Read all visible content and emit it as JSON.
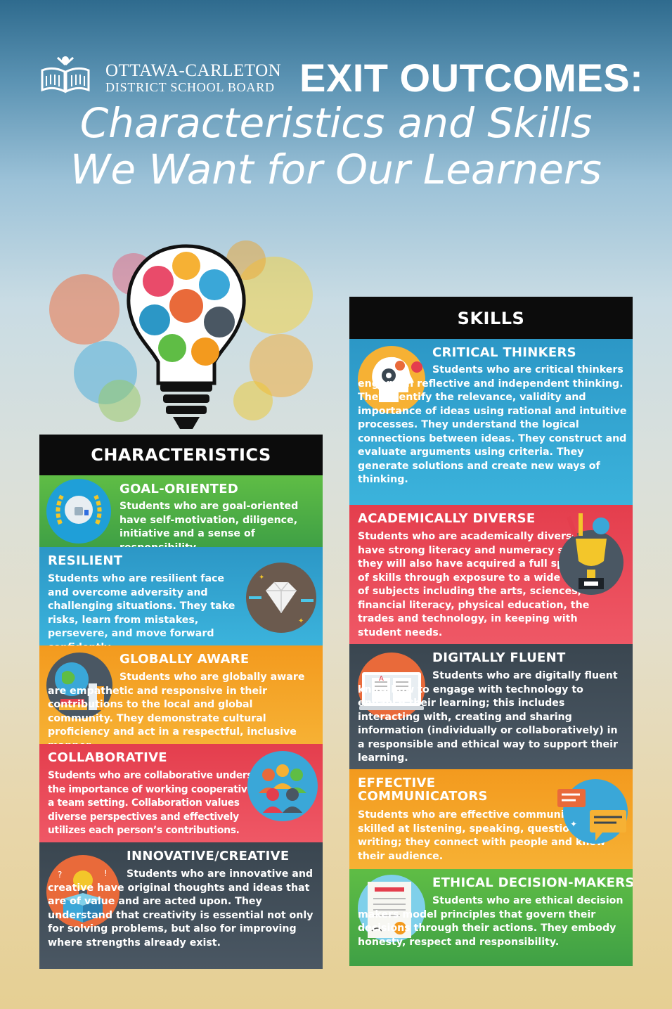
{
  "header": {
    "org_line1": "OTTAWA-CARLETON",
    "org_line2": "DISTRICT SCHOOL BOARD",
    "title": "EXIT OUTCOMES:",
    "subtitle_line1": "Characteristics and Skills",
    "subtitle_line2": "We Want for Our Learners"
  },
  "characteristics": {
    "heading": "CHARACTERISTICS",
    "items": [
      {
        "title": "GOAL-ORIENTED",
        "text": "Students who are goal-oriented have self-motivation, diligence, initiative and a sense of responsibility.",
        "icon": "thumbs-up-laurel-icon"
      },
      {
        "title": "RESILIENT",
        "text": "Students who are resilient face and overcome adversity and challenging situations. They take risks, learn from mistakes, persevere, and move forward confidently.",
        "icon": "diamond-icon"
      },
      {
        "title": "GLOBALLY AWARE",
        "text": "Students who are globally aware are empathetic and responsive in their contributions to the local and global community. They demonstrate cultural proficiency and act in a respectful, inclusive manner.",
        "icon": "globe-books-icon"
      },
      {
        "title": "COLLABORATIVE",
        "text": "Students who are collaborative understand the importance of working cooperatively in a team setting. Collaboration values diverse perspectives and effectively utilizes each person’s contributions.",
        "icon": "people-group-icon"
      },
      {
        "title": "INNOVATIVE/CREATIVE",
        "text": "Students who are innovative and creative have original thoughts and ideas that are of value and are acted upon. They understand that creativity is essential not only for solving problems, but also for improving where strengths already exist.",
        "icon": "lightbulb-box-icon"
      }
    ]
  },
  "skills": {
    "heading": "SKILLS",
    "items": [
      {
        "title": "CRITICAL THINKERS",
        "text": "Students who are critical thinkers engage in reflective and independent thinking. They identify the relevance, validity and importance of ideas using rational and intuitive processes. They understand the logical connections between ideas. They construct and evaluate arguments using criteria. They generate solutions and create new ways of thinking.",
        "icon": "head-gears-icon"
      },
      {
        "title": "ACADEMICALLY DIVERSE",
        "text": "Students who are academically diverse have strong literacy and numeracy skills; they will also have acquired a full spectrum of skills through exposure to a wide range of subjects including the arts, sciences, financial literacy, physical education, the trades and technology, in keeping with student needs.",
        "icon": "trophy-icon"
      },
      {
        "title": "DIGITALLY FLUENT",
        "text": "Students who are digitally fluent know how to engage with technology to enhance their learning; this includes interacting with, creating and sharing information (individually or collaboratively) in a responsible and ethical way to support their learning.",
        "icon": "laptop-book-icon"
      },
      {
        "title_line1": "EFFECTIVE",
        "title_line2": "COMMUNICATORS",
        "text": "Students who are effective communicators are skilled at listening, speaking, questioning, and writing; they connect with people and know their audience.",
        "icon": "speech-bubbles-icon"
      },
      {
        "title": "ETHICAL DECISION-MAKERS",
        "text": "Students who are ethical decision makers model principles that govern their decisions through their actions. They embody honesty, respect and responsibility.",
        "icon": "certificate-icon"
      }
    ]
  }
}
